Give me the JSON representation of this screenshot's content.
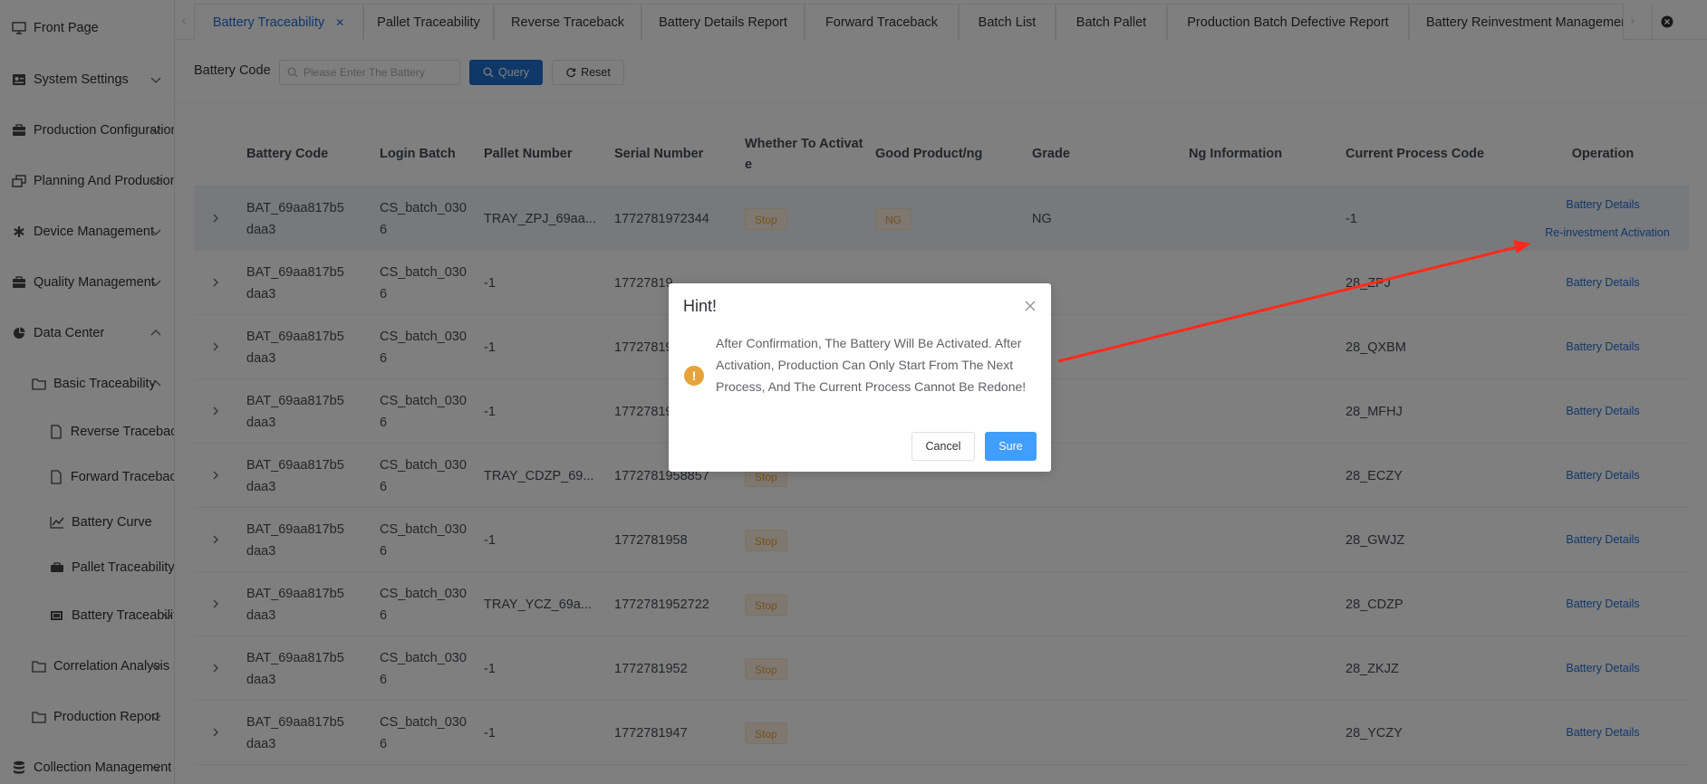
{
  "sidebar": {
    "items": [
      {
        "label": "Front Page",
        "icon": "monitor-icon"
      },
      {
        "label": "System Settings",
        "icon": "id-card-icon"
      },
      {
        "label": "Production Configuration",
        "icon": "briefcase-icon"
      },
      {
        "label": "Planning And Production",
        "icon": "copy-icon"
      },
      {
        "label": "Device Management",
        "icon": "asterisk-icon"
      },
      {
        "label": "Quality Management",
        "icon": "briefcase-icon"
      },
      {
        "label": "Data Center",
        "icon": "pie-chart-icon"
      },
      {
        "label": "Basic Traceability",
        "icon": "folder-icon"
      },
      {
        "label": "Reverse Traceback",
        "icon": "document-icon"
      },
      {
        "label": "Forward Traceback",
        "icon": "document-icon"
      },
      {
        "label": "Battery Curve",
        "icon": "line-chart-icon"
      },
      {
        "label": "Pallet Traceability",
        "icon": "toolbox-icon"
      },
      {
        "label": "Battery Traceability",
        "icon": "battery-icon"
      },
      {
        "label": "Correlation Analysis",
        "icon": "folder-icon"
      },
      {
        "label": "Production Report",
        "icon": "folder-icon"
      },
      {
        "label": "Collection Management",
        "icon": "database-icon"
      }
    ]
  },
  "tabs": [
    {
      "label": "Battery Traceability",
      "active": true
    },
    {
      "label": "Pallet Traceability"
    },
    {
      "label": "Reverse Traceback"
    },
    {
      "label": "Battery Details Report"
    },
    {
      "label": "Forward Traceback"
    },
    {
      "label": "Batch List"
    },
    {
      "label": "Batch Pallet"
    },
    {
      "label": "Production Batch Defective Report"
    },
    {
      "label": "Battery Reinvestment Management"
    }
  ],
  "search": {
    "label": "Battery Code",
    "placeholder": "Please Enter The Battery",
    "query_label": "Query",
    "reset_label": "Reset"
  },
  "table": {
    "columns": [
      "Battery Code",
      "Login Batch",
      "Pallet Number",
      "Serial Number",
      "Whether To Activate",
      "Good Product/ng",
      "Grade",
      "Ng Information",
      "Current Process Code",
      "Operation"
    ],
    "rows": [
      {
        "code": "BAT_69aa817b5daa3",
        "batch": "CS_batch_0306",
        "pallet": "TRAY_ZPJ_69aa...",
        "serial": "1772781972344",
        "activate": "Stop",
        "good": "NG",
        "grade": "NG",
        "ng_info": "",
        "process": "-1",
        "ops": [
          "Battery Details",
          "Re-investment Activation"
        ]
      },
      {
        "code": "BAT_69aa817b5daa3",
        "batch": "CS_batch_0306",
        "pallet": "-1",
        "serial": "17727819",
        "activate": "",
        "good": "",
        "grade": "",
        "ng_info": "",
        "process": "28_ZPJ",
        "ops": [
          "Battery Details"
        ]
      },
      {
        "code": "BAT_69aa817b5daa3",
        "batch": "CS_batch_0306",
        "pallet": "-1",
        "serial": "17727819",
        "activate": "",
        "good": "",
        "grade": "",
        "ng_info": "",
        "process": "28_QXBM",
        "ops": [
          "Battery Details"
        ]
      },
      {
        "code": "BAT_69aa817b5daa3",
        "batch": "CS_batch_0306",
        "pallet": "-1",
        "serial": "17727819",
        "activate": "",
        "good": "",
        "grade": "",
        "ng_info": "",
        "process": "28_MFHJ",
        "ops": [
          "Battery Details"
        ]
      },
      {
        "code": "BAT_69aa817b5daa3",
        "batch": "CS_batch_0306",
        "pallet": "TRAY_CDZP_69...",
        "serial": "1772781958857",
        "activate": "Stop",
        "good": "",
        "grade": "",
        "ng_info": "",
        "process": "28_ECZY",
        "ops": [
          "Battery Details"
        ]
      },
      {
        "code": "BAT_69aa817b5daa3",
        "batch": "CS_batch_0306",
        "pallet": "-1",
        "serial": "1772781958",
        "activate": "Stop",
        "good": "",
        "grade": "",
        "ng_info": "",
        "process": "28_GWJZ",
        "ops": [
          "Battery Details"
        ]
      },
      {
        "code": "BAT_69aa817b5daa3",
        "batch": "CS_batch_0306",
        "pallet": "TRAY_YCZ_69a...",
        "serial": "1772781952722",
        "activate": "Stop",
        "good": "",
        "grade": "",
        "ng_info": "",
        "process": "28_CDZP",
        "ops": [
          "Battery Details"
        ]
      },
      {
        "code": "BAT_69aa817b5daa3",
        "batch": "CS_batch_0306",
        "pallet": "-1",
        "serial": "1772781952",
        "activate": "Stop",
        "good": "",
        "grade": "",
        "ng_info": "",
        "process": "28_ZKJZ",
        "ops": [
          "Battery Details"
        ]
      },
      {
        "code": "BAT_69aa817b5daa3",
        "batch": "CS_batch_0306",
        "pallet": "-1",
        "serial": "1772781947",
        "activate": "Stop",
        "good": "",
        "grade": "",
        "ng_info": "",
        "process": "28_YCZY",
        "ops": [
          "Battery Details"
        ]
      }
    ]
  },
  "dialog": {
    "title": "Hint!",
    "message": "After Confirmation, The Battery Will Be Activated. After Activation, Production Can Only Start From The Next Process, And The Current Process Cannot Be Redone!",
    "cancel_label": "Cancel",
    "confirm_label": "Sure"
  },
  "colors": {
    "primary": "#1f6fd1",
    "warning": "#e6a23c",
    "confirm": "#409eff",
    "annotation_arrow": "#ff0000"
  }
}
